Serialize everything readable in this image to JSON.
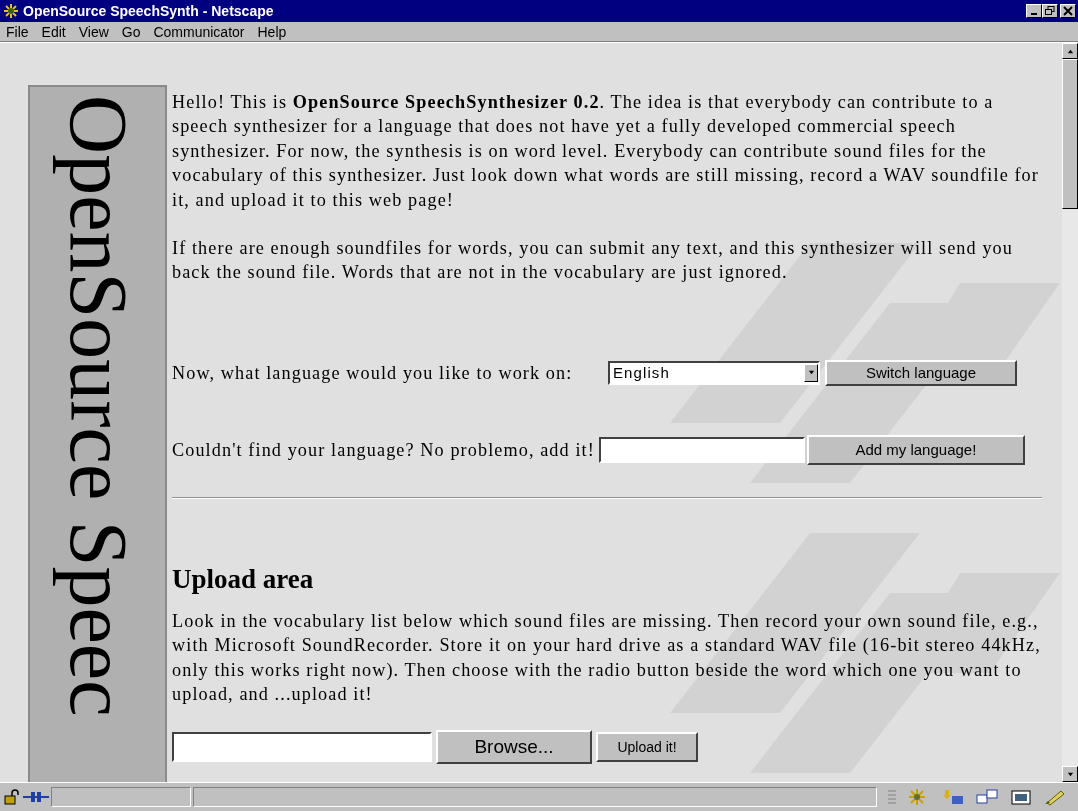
{
  "window": {
    "title": "OpenSource SpeechSynth - Netscape"
  },
  "menu": [
    "File",
    "Edit",
    "View",
    "Go",
    "Communicator",
    "Help"
  ],
  "sidebar": {
    "title": "OpenSource Speec"
  },
  "intro": [
    "Hello! This is **OpenSource SpeechSynthesizer 0.2**. The idea is that everybody can contribute to a speech synthesizer for a language that does not have yet a fully developed commercial speech synthesizer. For now, the synthesis is on word level. Everybody can contribute sound files for the vocabulary of this synthesizer. Just look down what words are still missing, record a WAV soundfile for it, and upload it to this web page!",
    "If there are enough soundfiles for words, you can submit any text, and this synthesizer will send you back the sound file. Words that are not in the vocabulary are just ignored."
  ],
  "language_form": {
    "label": "Now, what language would you like to work on:",
    "value": "English",
    "button": "Switch language"
  },
  "add_form": {
    "label": "Couldn't find your language? No problemo, add it!",
    "button": "Add my language!"
  },
  "upload": {
    "heading": "Upload area",
    "text": "Look in the vocabulary list below which sound files are missing. Then record your own sound file, e.g., with Microsoft SoundRecorder. Store it on your hard drive as a standard WAV file (16-bit stereo 44kHz, only this works right now). Then choose with the radio button beside the word which one you want to upload, and ...upload it!",
    "browse_button": "Browse...",
    "upload_button": "Upload it!"
  }
}
